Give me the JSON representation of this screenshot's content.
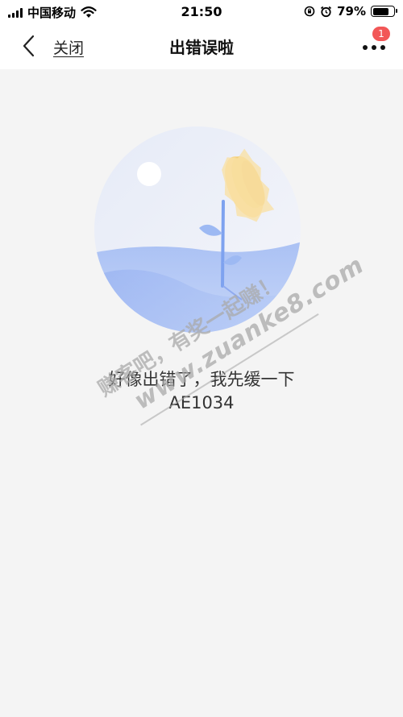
{
  "status_bar": {
    "carrier": "中国移动",
    "time": "21:50",
    "battery": "79%",
    "battery_level": 0.79
  },
  "nav": {
    "close_label": "关闭",
    "title": "出错误啦",
    "badge_count": "1"
  },
  "error": {
    "message": "好像出错了，我先缓一下",
    "code": "AE1034"
  },
  "watermark": {
    "line1": "赚客吧，有奖一起赚！",
    "line2": "www.zuanke8.com"
  },
  "colors": {
    "badge": "#f25757",
    "page_bg": "#f4f4f4",
    "illustration_circle": "#e9edf8",
    "hill": "#9fb8f2",
    "sunflower": "#f4cf7a"
  },
  "icons": [
    "signal-icon",
    "wifi-icon",
    "orientation-lock-icon",
    "alarm-icon",
    "battery-icon",
    "back-chevron-icon",
    "more-dots-icon"
  ]
}
